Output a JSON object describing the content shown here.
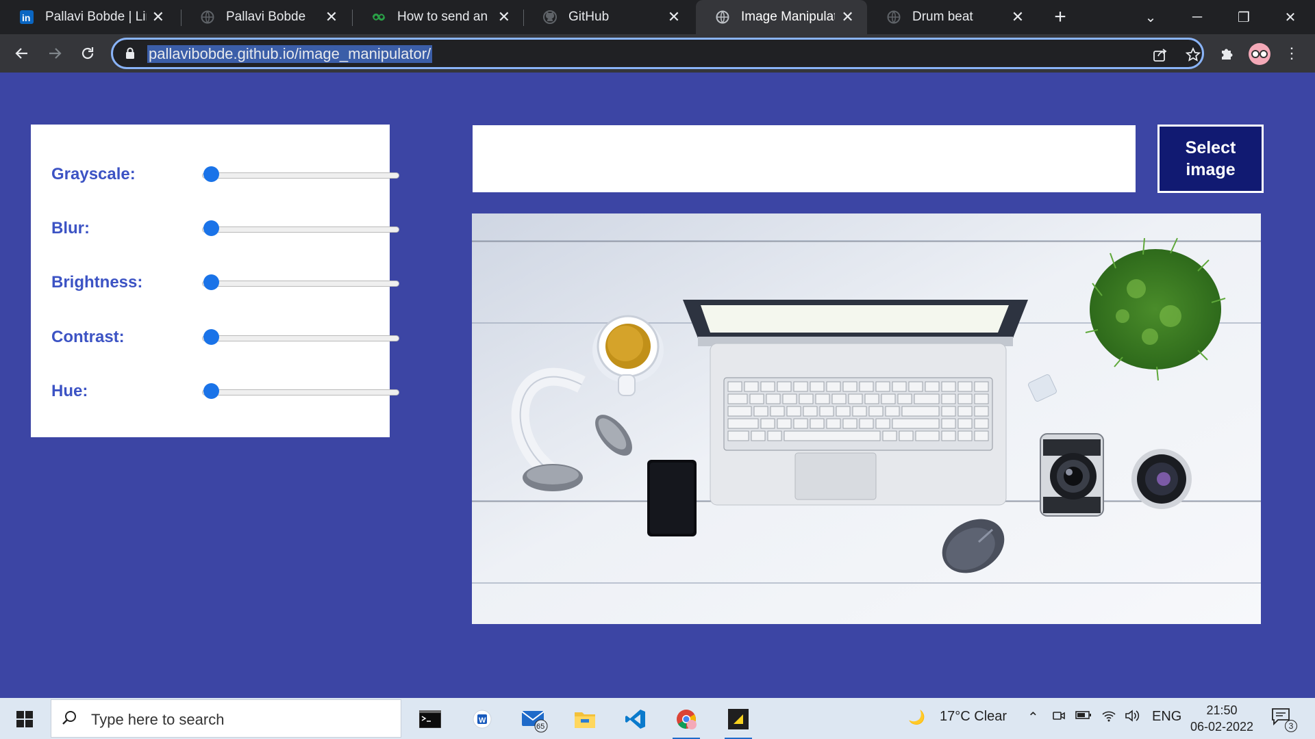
{
  "browser": {
    "tabs": [
      {
        "title": "Pallavi Bobde | LinkedIn",
        "icon": "linkedin-icon"
      },
      {
        "title": "Pallavi Bobde",
        "icon": "globe-icon"
      },
      {
        "title": "How to send an em",
        "icon": "codeanywhere-icon"
      },
      {
        "title": "GitHub",
        "icon": "github-icon"
      },
      {
        "title": "Image Manipulator",
        "icon": "globe-icon",
        "active": true
      },
      {
        "title": "Drum beat",
        "icon": "globe-icon"
      }
    ],
    "url": "pallavibobde.github.io/image_manipulator/"
  },
  "page": {
    "background": "#3c45a4",
    "controls": [
      {
        "label": "Grayscale:",
        "value": 0
      },
      {
        "label": "Blur:",
        "value": 0
      },
      {
        "label": "Brightness:",
        "value": 0
      },
      {
        "label": "Contrast:",
        "value": 0
      },
      {
        "label": "Hue:",
        "value": 0
      }
    ],
    "select_button_label": "Select image",
    "label_color": "#3c53c4",
    "button_color": "#111a72"
  },
  "taskbar": {
    "search_placeholder": "Type here to search",
    "mail_badge": "65",
    "weather": "17°C  Clear",
    "language": "ENG",
    "time": "21:50",
    "date": "06-02-2022",
    "notification_count": "3"
  }
}
